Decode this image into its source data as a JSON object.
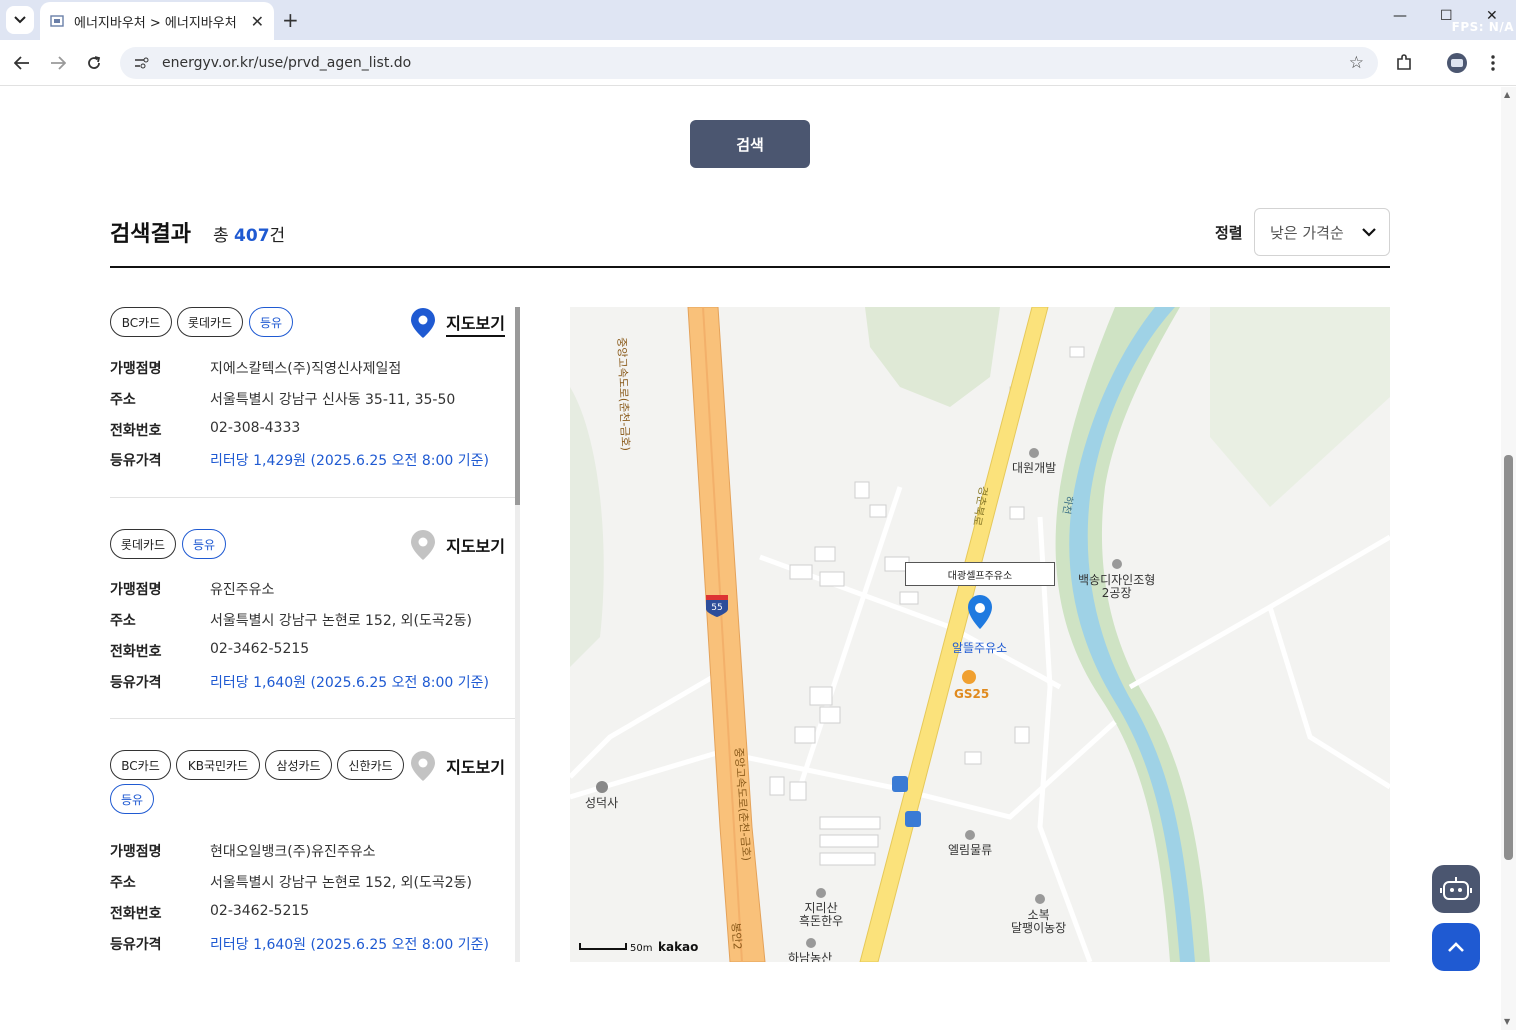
{
  "browser": {
    "tab_title": "에너지바우처 > 에너지바우처",
    "url": "energyv.or.kr/use/prvd_agen_list.do",
    "fps_label": "FPS: N/A"
  },
  "search": {
    "button_label": "검색"
  },
  "results": {
    "title": "검색결과",
    "count_prefix": "총 ",
    "count": "407",
    "count_suffix": "건",
    "sort_label": "정렬",
    "sort_value": "낮은 가격순"
  },
  "labels": {
    "name": "가맹점명",
    "address": "주소",
    "phone": "전화번호",
    "price": "등유가격",
    "map_view": "지도보기"
  },
  "cards": [
    {
      "tags": [
        "BC카드",
        "롯데카드",
        "등유"
      ],
      "name": "지에스칼텍스(주)직영신사제일점",
      "address": "서울특별시 강남구 신사동  35-11, 35-50",
      "phone": "02-308-4333",
      "price": "리터당 1,429원 (2025.6.25 오전 8:00 기준)",
      "active": true
    },
    {
      "tags": [
        "롯데카드",
        "등유"
      ],
      "name": "유진주유소",
      "address": "서울특별시 강남구  논현로 152, 외(도곡2동)",
      "phone": "02-3462-5215",
      "price": "리터당 1,640원 (2025.6.25 오전 8:00 기준)",
      "active": false
    },
    {
      "tags": [
        "BC카드",
        "KB국민카드",
        "삼성카드",
        "신한카드",
        "등유"
      ],
      "name": "현대오일뱅크(주)유진주유소",
      "address": "서울특별시 강남구  논현로 152, 외(도곡2동)",
      "phone": "02-3462-5215",
      "price": "리터당 1,640원 (2025.6.25 오전 8:00 기준)",
      "active": false
    }
  ],
  "map": {
    "callout": "대광셀프주유소",
    "pin_label": "알뜰주유소",
    "gs_label": "GS25",
    "places": [
      "대원개발",
      "백송디자인조형\n2공장",
      "성덕사",
      "엘림물류",
      "지리산\n흑돈한우",
      "소복\n달팽이농장",
      "하남농산"
    ],
    "road_labels": [
      "중앙고속도로(춘천-금호)",
      "경춘북로",
      "중앙고속도로(춘천-금호)",
      "봉안2",
      "하천"
    ],
    "route_shield": "55",
    "scale": "50m",
    "provider": "kakao"
  },
  "colors": {
    "accent": "#1f5ad2",
    "search_button": "#4b5670",
    "chatbot": "#4b5670"
  }
}
